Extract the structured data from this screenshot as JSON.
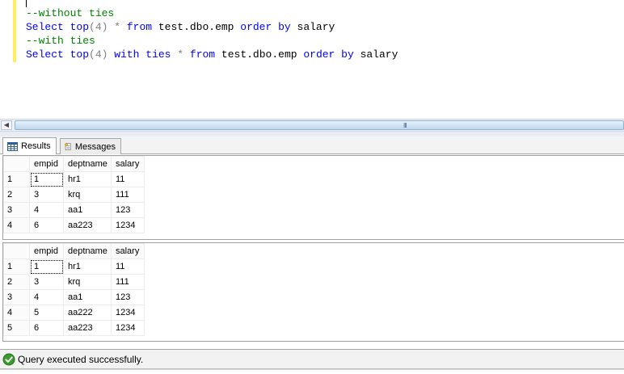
{
  "editor": {
    "lines": [
      [
        {
          "t": "--without ties",
          "c": "cm"
        }
      ],
      [
        {
          "t": "Select",
          "c": "kw"
        },
        {
          "t": " ",
          "c": ""
        },
        {
          "t": "top",
          "c": "kw"
        },
        {
          "t": "(4) * ",
          "c": "gr"
        },
        {
          "t": "from",
          "c": "kw"
        },
        {
          "t": " test.dbo.emp ",
          "c": ""
        },
        {
          "t": "order",
          "c": "kw"
        },
        {
          "t": " ",
          "c": ""
        },
        {
          "t": "by",
          "c": "kw"
        },
        {
          "t": " salary",
          "c": ""
        }
      ],
      [
        {
          "t": "--with ties",
          "c": "cm"
        }
      ],
      [
        {
          "t": "Select",
          "c": "kw"
        },
        {
          "t": " ",
          "c": ""
        },
        {
          "t": "top",
          "c": "kw"
        },
        {
          "t": "(4) ",
          "c": "gr"
        },
        {
          "t": "with",
          "c": "kw"
        },
        {
          "t": " ",
          "c": ""
        },
        {
          "t": "ties",
          "c": "kw"
        },
        {
          "t": " * ",
          "c": "gr"
        },
        {
          "t": "from",
          "c": "kw"
        },
        {
          "t": " test.dbo.emp ",
          "c": ""
        },
        {
          "t": "order",
          "c": "kw"
        },
        {
          "t": " ",
          "c": ""
        },
        {
          "t": "by",
          "c": "kw"
        },
        {
          "t": " salary",
          "c": ""
        }
      ]
    ]
  },
  "scrollbar": {
    "grip": "III"
  },
  "tabs": {
    "results_label": "Results",
    "messages_label": "Messages"
  },
  "grids": [
    {
      "columns": [
        "empid",
        "deptname",
        "salary"
      ],
      "rows": [
        [
          "1",
          "1",
          "hr1",
          "11"
        ],
        [
          "2",
          "3",
          "krq",
          "111"
        ],
        [
          "3",
          "4",
          "aa1",
          "123"
        ],
        [
          "4",
          "6",
          "aa223",
          "1234"
        ]
      ]
    },
    {
      "columns": [
        "empid",
        "deptname",
        "salary"
      ],
      "rows": [
        [
          "1",
          "1",
          "hr1",
          "11"
        ],
        [
          "2",
          "3",
          "krq",
          "111"
        ],
        [
          "3",
          "4",
          "aa1",
          "123"
        ],
        [
          "4",
          "5",
          "aa222",
          "1234"
        ],
        [
          "5",
          "6",
          "aa223",
          "1234"
        ]
      ]
    }
  ],
  "status": {
    "message": "Query executed successfully.",
    "icon": "check-circle-icon",
    "icon_color": "#3a9a2f"
  },
  "colors": {
    "keyword": "#0000ff",
    "comment": "#008000",
    "operator": "#808080",
    "change_bar": "#ffee62"
  }
}
